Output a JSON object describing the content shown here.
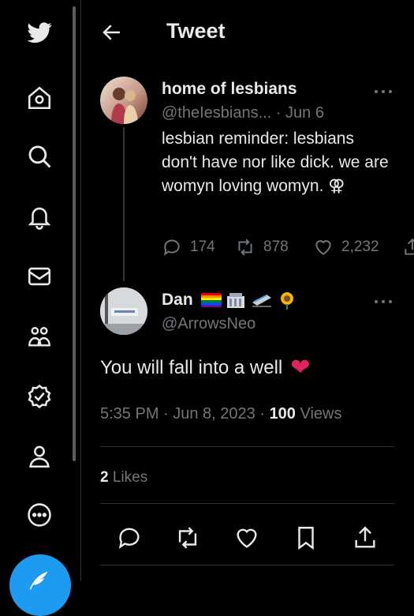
{
  "header": {
    "title": "Tweet"
  },
  "nav": {
    "items": [
      "twitter-logo",
      "home",
      "explore",
      "notifications",
      "messages",
      "communities",
      "verified",
      "profile",
      "more"
    ]
  },
  "parent_tweet": {
    "display_name": "home of lesbians",
    "handle": "@theIesbians...",
    "date": "· Jun 6",
    "text": "lesbian reminder: lesbians don't have nor like dick. we are womyn loving womyn. ⚢",
    "replies": "174",
    "retweets": "878",
    "likes": "2,232"
  },
  "main_tweet": {
    "display_name": "Dan",
    "handle": "@ArrowsNeo",
    "text": "You will fall into a well",
    "emoji": "❤",
    "time": "5:35 PM · Jun 8, 2023 · ",
    "views_count": "100",
    "views_label": " Views",
    "likes_count": "2",
    "likes_label": " Likes"
  },
  "colors": {
    "accent": "#1d9bf0",
    "muted": "#71767b",
    "heart": "#f91880"
  }
}
